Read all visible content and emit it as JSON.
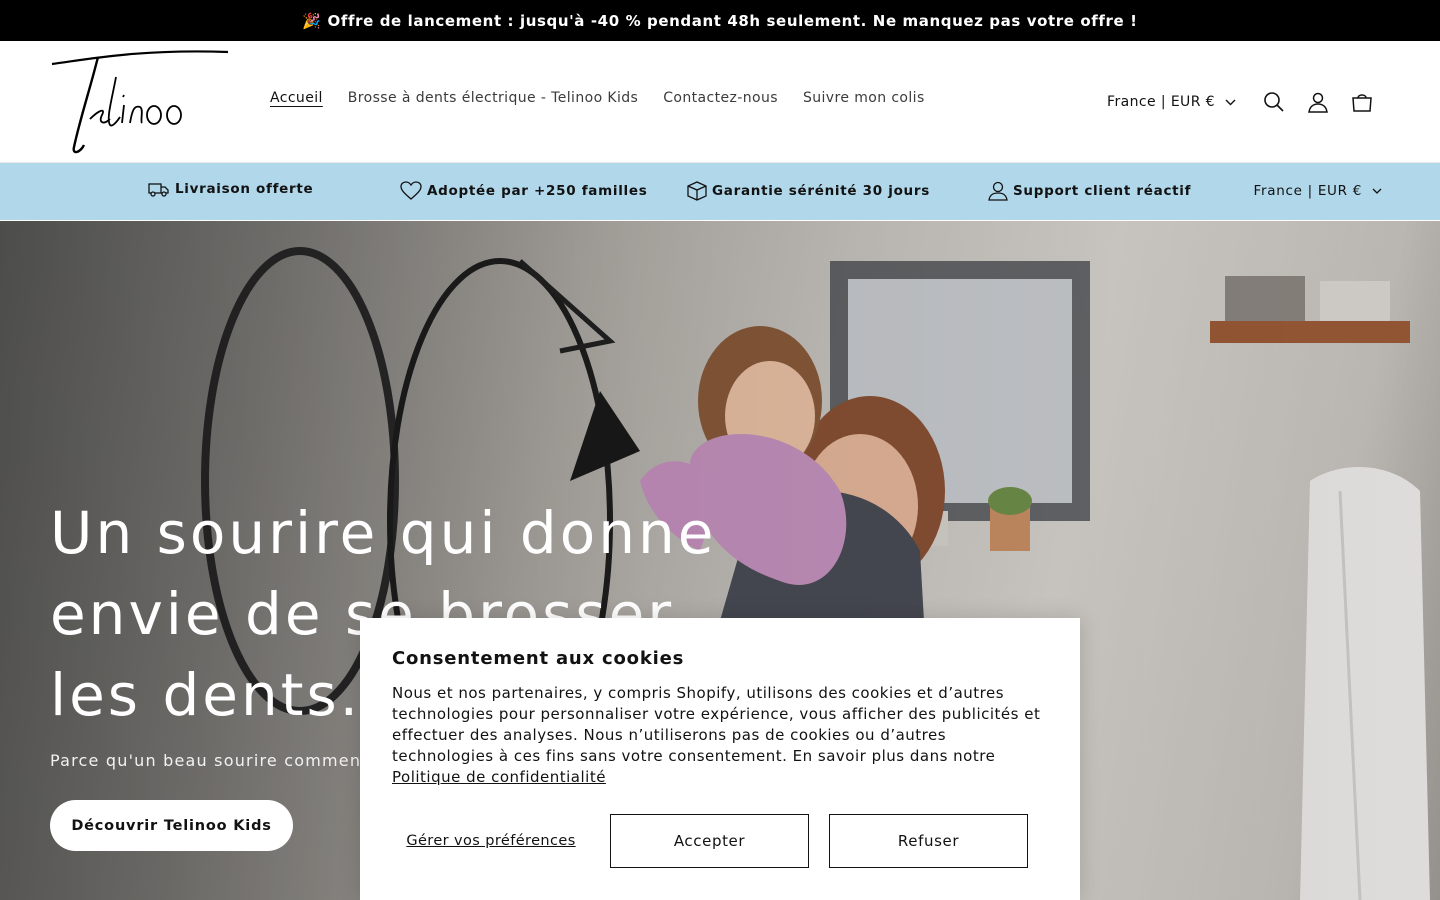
{
  "announcement": {
    "text": "🎉 Offre de lancement : jusqu'à -40 % pendant 48h seulement. Ne manquez pas votre offre !"
  },
  "header": {
    "nav": [
      {
        "label": "Accueil"
      },
      {
        "label": "Brosse à dents électrique - Telinoo Kids"
      },
      {
        "label": "Contactez-nous"
      },
      {
        "label": "Suivre mon colis"
      }
    ],
    "country_selector": "France | EUR €"
  },
  "trust_bar": {
    "items": [
      {
        "label": "Livraison offerte",
        "icon": "truck-icon"
      },
      {
        "label": "Adoptée par +250 familles",
        "icon": "heart-icon"
      },
      {
        "label": "Garantie sérénité 30 jours",
        "icon": "box-icon"
      },
      {
        "label": "Support client réactif",
        "icon": "user-icon"
      }
    ],
    "country_selector": "France | EUR €"
  },
  "hero": {
    "title": "Un sourire qui donne envie de se brosser les dents.",
    "subtitle": "Parce qu'un beau sourire commence",
    "cta": "Découvrir Telinoo Kids"
  },
  "cookie_banner": {
    "title": "Consentement aux cookies",
    "body": "Nous et nos partenaires, y compris Shopify, utilisons des cookies et d’autres technologies pour personnaliser votre expérience, vous afficher des publicités et effectuer des analyses. Nous n’utiliserons pas de cookies ou d’autres technologies à ces fins sans votre consentement. En savoir plus dans notre ",
    "policy_link": "Politique de confidentialité",
    "manage_label": "Gérer vos préférences",
    "accept_label": "Accepter",
    "decline_label": "Refuser"
  },
  "colors": {
    "announcement_bg": "#000000",
    "trust_bar_bg": "#b0d7ea",
    "text": "#121212"
  }
}
